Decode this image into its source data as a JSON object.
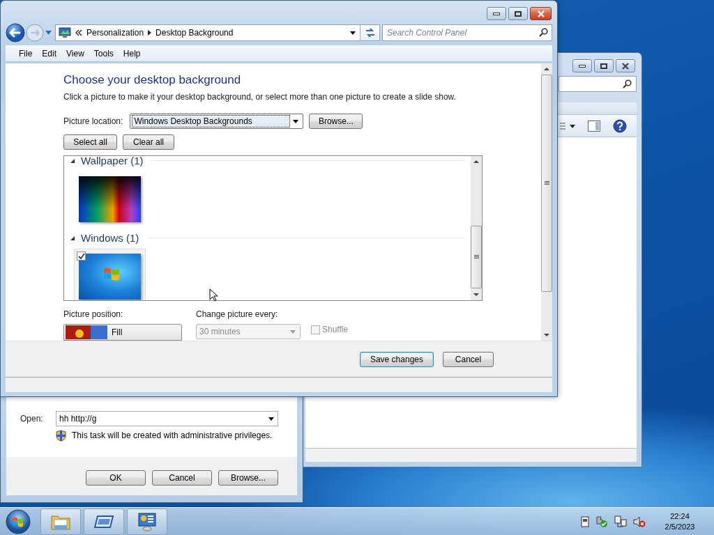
{
  "main_window": {
    "breadcrumb": [
      "Personalization",
      "Desktop Background"
    ],
    "search_placeholder": "Search Control Panel",
    "menu": [
      "File",
      "Edit",
      "View",
      "Tools",
      "Help"
    ],
    "heading": "Choose your desktop background",
    "description": "Click a picture to make it your desktop background, or select more than one picture to create a slide show.",
    "picture_location": {
      "label": "Picture location:",
      "value": "Windows Desktop Backgrounds"
    },
    "browse_button": "Browse...",
    "select_all_button": "Select all",
    "clear_all_button": "Clear all",
    "groups": [
      {
        "title": "Wallpaper (1)",
        "expanded": true,
        "pictures": [
          {
            "kind": "spectrum",
            "checked": false
          }
        ]
      },
      {
        "title": "Windows (1)",
        "expanded": true,
        "pictures": [
          {
            "kind": "windows",
            "checked": true
          }
        ]
      }
    ],
    "picture_position": {
      "label": "Picture position:",
      "value": "Fill"
    },
    "change_picture": {
      "label": "Change picture every:",
      "value": "30 minutes",
      "disabled": true
    },
    "shuffle": {
      "label": "Shuffle",
      "checked": false,
      "disabled": true
    },
    "buttons": [
      {
        "label": "Save changes",
        "default": true
      },
      {
        "label": "Cancel",
        "default": false
      }
    ]
  },
  "run_dialog": {
    "open_label": "Open:",
    "value": "hh http://g",
    "note": "This task will be created with administrative privileges.",
    "buttons": [
      "OK",
      "Cancel",
      "Browse..."
    ]
  },
  "taskbar": {
    "time": "22:24",
    "date": "2/5/2023"
  }
}
